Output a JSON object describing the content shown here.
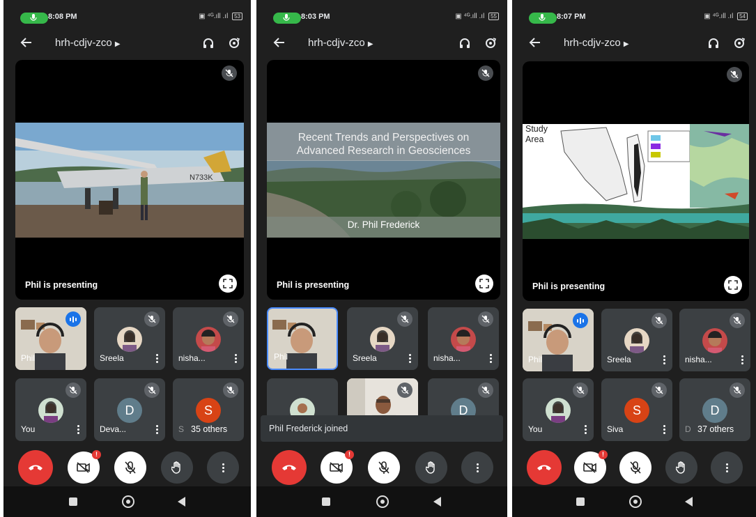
{
  "screens": [
    {
      "status": {
        "time": "8:08 PM",
        "battery": "53"
      },
      "meeting": {
        "title": "hrh-cdjv-zco"
      },
      "stage": {
        "presenting": "Phil is presenting"
      },
      "tiles": [
        {
          "name": "Phil"
        },
        {
          "name": "Sreela"
        },
        {
          "name": "nisha..."
        },
        {
          "name": "You"
        },
        {
          "name": "Deva...",
          "initial": "D"
        },
        {
          "name": "S",
          "initial": "S",
          "others": "35 others"
        }
      ]
    },
    {
      "status": {
        "time": "8:03 PM",
        "battery": "55"
      },
      "meeting": {
        "title": "hrh-cdjv-zco"
      },
      "stage": {
        "presenting": "Phil is presenting",
        "slide_title": "Recent Trends and Perspectives on Advanced Research in Geosciences",
        "slide_author": "Dr. Phil Frederick"
      },
      "tiles": [
        {
          "name": "Phil"
        },
        {
          "name": "Sreela"
        },
        {
          "name": "nisha..."
        },
        {
          "initial": "D"
        }
      ],
      "toast": "Phil Frederick joined"
    },
    {
      "status": {
        "time": "8:07 PM",
        "battery": "54"
      },
      "meeting": {
        "title": "hrh-cdjv-zco"
      },
      "stage": {
        "presenting": "Phil is presenting",
        "slide_title": "Study Area"
      },
      "tiles": [
        {
          "name": "Phil"
        },
        {
          "name": "Sreela"
        },
        {
          "name": "nisha..."
        },
        {
          "name": "You"
        },
        {
          "name": "Siva",
          "initial": "S"
        },
        {
          "name": "D",
          "initial": "D",
          "others": "37 others"
        }
      ]
    }
  ],
  "badge": "!",
  "icons": {
    "back": "arrow-left-icon",
    "headphones": "headphones-icon",
    "flip": "camera-flip-icon",
    "mic_off": "mic-off-icon",
    "fullscreen": "fullscreen-icon",
    "end": "end-call-icon",
    "camera_off": "camera-off-icon",
    "hand": "raise-hand-icon",
    "more": "more-vert-icon"
  },
  "colors": {
    "end_call": "#e53935",
    "speaking": "#1a73e8",
    "call_pill": "#36b84a",
    "initial_s": "#d84315",
    "initial_d": "#607d8b"
  }
}
